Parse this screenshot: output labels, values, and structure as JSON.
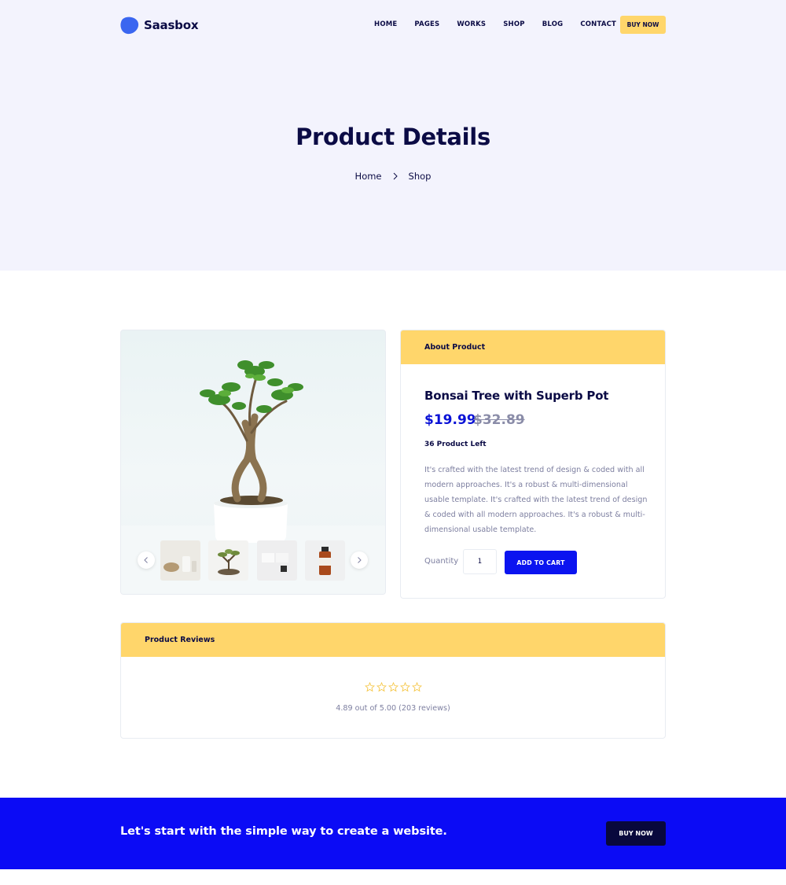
{
  "brand": {
    "name": "Saasbox",
    "accent": "#0b14f0",
    "yellow": "#ffd66b",
    "navy": "#0b0b45"
  },
  "nav": {
    "items": [
      {
        "label": "HOME"
      },
      {
        "label": "PAGES"
      },
      {
        "label": "WORKS"
      },
      {
        "label": "SHOP"
      },
      {
        "label": "BLOG"
      },
      {
        "label": "CONTACT"
      }
    ],
    "cta_label": "BUY NOW"
  },
  "hero": {
    "title": "Product Details",
    "breadcrumb": [
      {
        "label": "Home"
      },
      {
        "label": "Shop"
      }
    ]
  },
  "gallery": {
    "prev_icon": "chevron-left-icon",
    "next_icon": "chevron-right-icon",
    "thumbnails": [
      {
        "name": "thumb-items"
      },
      {
        "name": "thumb-bonsai"
      },
      {
        "name": "thumb-boxes"
      },
      {
        "name": "thumb-bottle"
      }
    ]
  },
  "about": {
    "header": "About Product",
    "product_name": "Bonsai Tree with Superb Pot",
    "price": "$19.99",
    "old_price": "$32.89",
    "stock": "36 Product Left",
    "description": "It's crafted with the latest trend of design & coded with all modern approaches. It's a robust & multi-dimensional usable template. It's crafted with the latest trend of design & coded with all modern approaches. It's a robust & multi-dimensional usable template.",
    "quantity_label": "Quantity",
    "quantity_value": "1",
    "add_to_cart_label": "ADD TO CART"
  },
  "reviews": {
    "header": "Product Reviews",
    "star_count": 5,
    "star_color": "#f5c542",
    "summary": "4.89 out of 5.00 (203 reviews)"
  },
  "cta": {
    "text": "Let's start with the simple way to create a website.",
    "button_label": "BUY NOW"
  }
}
